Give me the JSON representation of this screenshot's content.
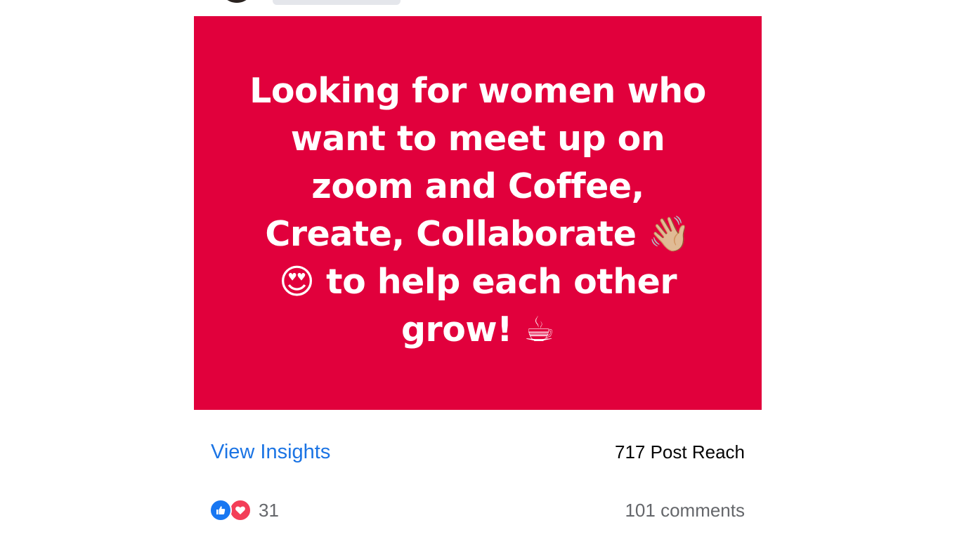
{
  "post": {
    "image_text": "Looking for women who\nwant to meet up on\nzoom and Coffee,\nCreate, Collaborate 👋🏼\n😍 to help each other\ngrow! ☕",
    "background_color": "#e1003c"
  },
  "insights": {
    "view_insights_label": "View Insights",
    "post_reach": "717 Post Reach"
  },
  "engagement": {
    "reaction_icons": [
      "like-icon",
      "love-icon"
    ],
    "reaction_count": "31",
    "comments": "101 comments"
  },
  "colors": {
    "link_blue": "#1b74e4",
    "like_blue": "#1877f2",
    "love_red": "#f33e58",
    "secondary_text": "#65676b"
  }
}
